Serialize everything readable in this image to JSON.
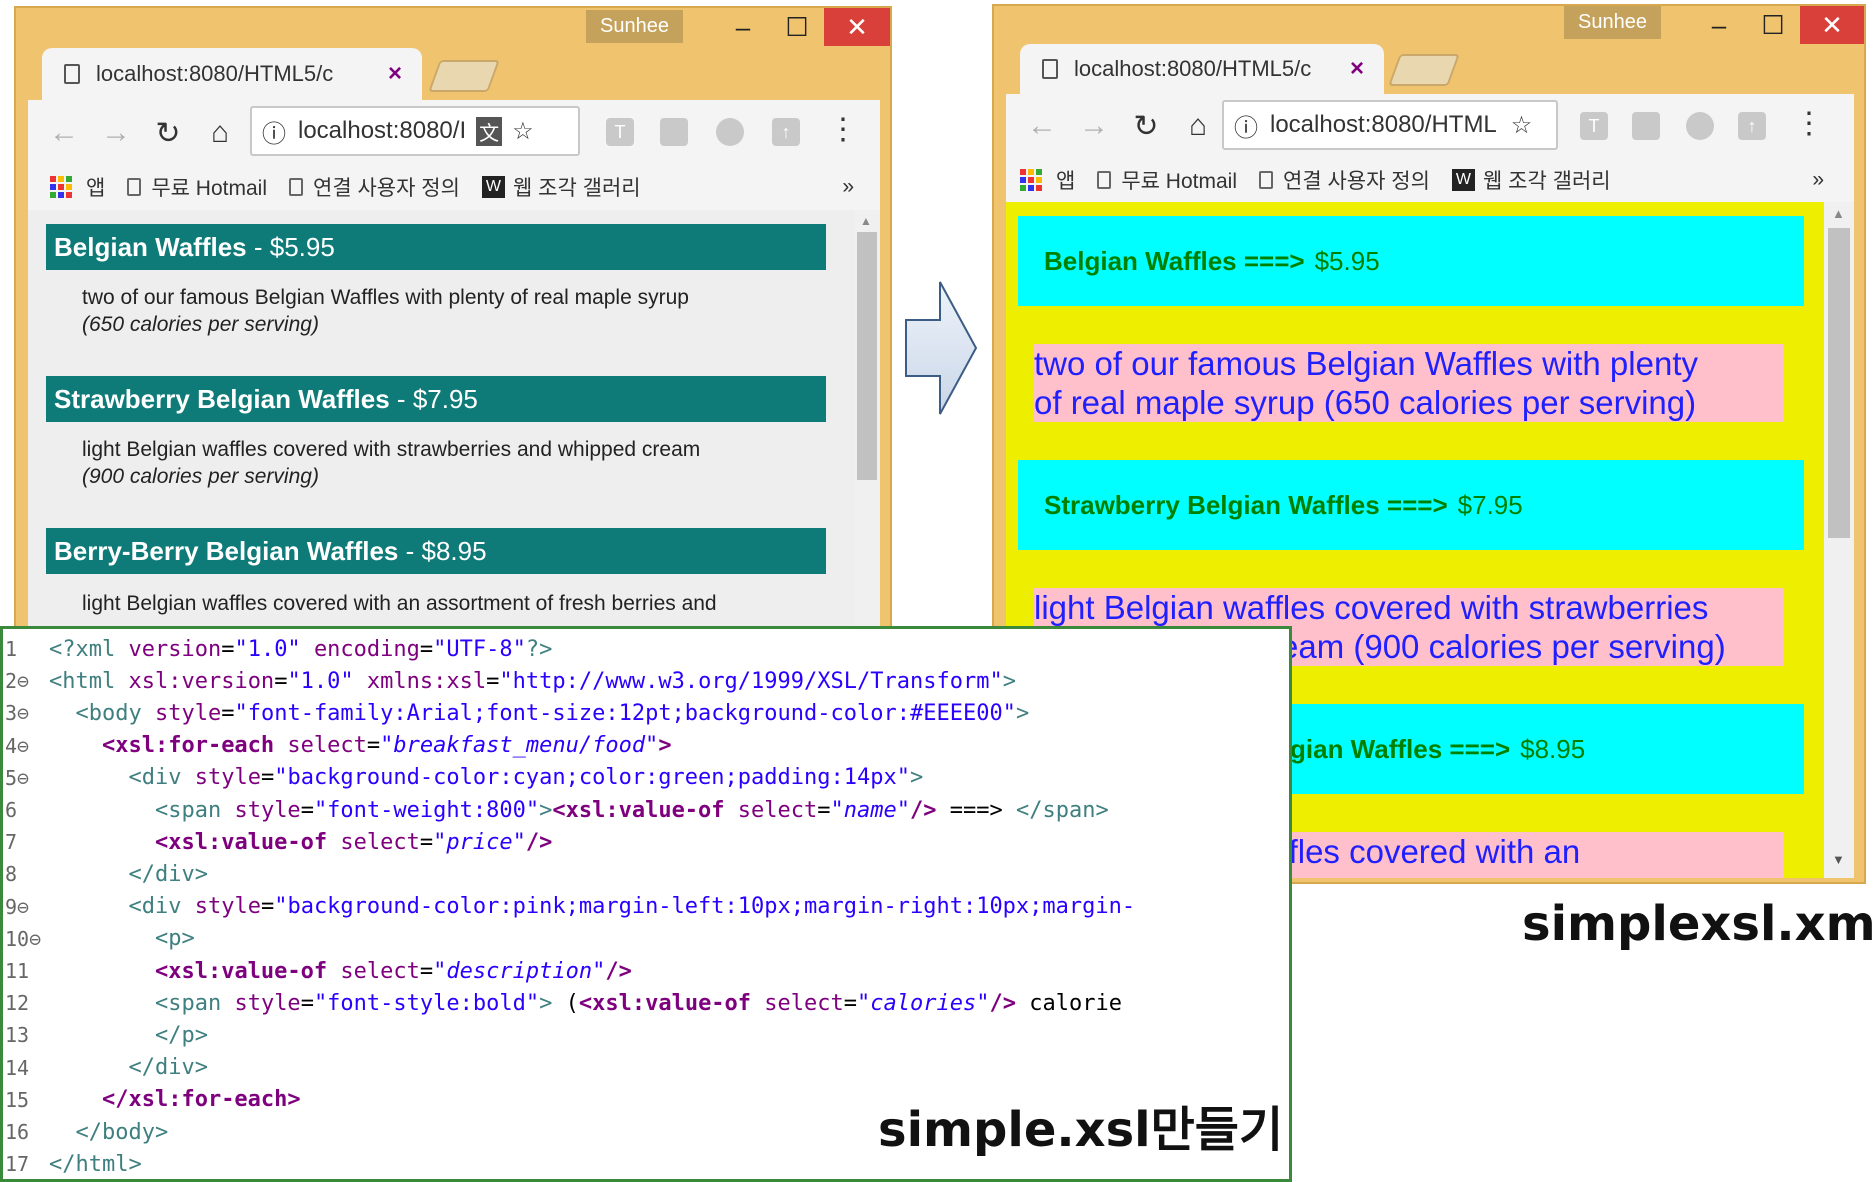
{
  "left_browser": {
    "user": "Sunhee",
    "controls": {
      "minimize": "–",
      "maximize": "☐",
      "close": "✕"
    },
    "tab_title": "localhost:8080/HTML5/c",
    "tab_close": "×",
    "address": "localhost:8080/I",
    "bookmarks": [
      "앱",
      "무료 Hotmail",
      "연결 사용자 정의",
      "웹 조각 갤러리"
    ],
    "more": "»",
    "foods": [
      {
        "name": "Belgian Waffles",
        "sep": " - ",
        "price": "$5.95",
        "desc": "two of our famous Belgian Waffles with plenty of real maple syrup",
        "cal": "(650 calories per serving)"
      },
      {
        "name": "Strawberry Belgian Waffles",
        "sep": " - ",
        "price": "$7.95",
        "desc": "light Belgian waffles covered with strawberries and whipped cream",
        "cal": "(900 calories per serving)"
      },
      {
        "name": "Berry-Berry Belgian Waffles",
        "sep": " - ",
        "price": "$8.95",
        "desc": "light Belgian waffles covered with an assortment of fresh berries and",
        "cal": ""
      }
    ]
  },
  "right_browser": {
    "user": "Sunhee",
    "controls": {
      "minimize": "–",
      "maximize": "☐",
      "close": "✕"
    },
    "tab_title": "localhost:8080/HTML5/c",
    "tab_close": "×",
    "address": "localhost:8080/HTML",
    "bookmarks": [
      "앱",
      "무료 Hotmail",
      "연결 사용자 정의",
      "웹 조각 갤러리"
    ],
    "more": "»",
    "blocks": [
      {
        "name": "Belgian Waffles ===>",
        "price": "$5.95",
        "desc_l1": "two of our famous Belgian Waffles with plenty",
        "desc_l2": "of real maple syrup (650 calories per serving)"
      },
      {
        "name": "Strawberry Belgian Waffles ===>",
        "price": "$7.95",
        "desc_l1": "light Belgian waffles covered with strawberries",
        "desc_l2": "eam (900 calories per serving)"
      },
      {
        "name": "gian Waffles ===>",
        "price": "$8.95",
        "desc_l1": "ffles covered with an",
        "desc_l2": ""
      }
    ]
  },
  "code_lines": [
    {
      "n": "1",
      "parts": [
        [
          "t",
          "<?"
        ],
        [
          "t",
          "xml "
        ],
        [
          "a",
          "version"
        ],
        [
          "p",
          "="
        ],
        [
          "s",
          "\"1.0\" "
        ],
        [
          "a",
          "encoding"
        ],
        [
          "p",
          "="
        ],
        [
          "s",
          "\"UTF-8\""
        ],
        [
          "t",
          "?>"
        ]
      ]
    },
    {
      "n": "2⊖",
      "parts": [
        [
          "t",
          "<html "
        ],
        [
          "a",
          "xsl:version"
        ],
        [
          "p",
          "="
        ],
        [
          "s",
          "\"1.0\" "
        ],
        [
          "a",
          "xmlns:xsl"
        ],
        [
          "p",
          "="
        ],
        [
          "s",
          "\"http://www.w3.org/1999/XSL/Transform\""
        ],
        [
          "t",
          ">"
        ]
      ]
    },
    {
      "n": "3⊖",
      "parts": [
        [
          "p",
          "  "
        ],
        [
          "t",
          "<body "
        ],
        [
          "a",
          "style"
        ],
        [
          "p",
          "="
        ],
        [
          "s",
          "\"font-family:Arial;font-size:12pt;background-color:#EEEE00\""
        ],
        [
          "t",
          ">"
        ]
      ]
    },
    {
      "n": "4⊖",
      "parts": [
        [
          "p",
          "    "
        ],
        [
          "x",
          "<xsl:for-each "
        ],
        [
          "a",
          "select"
        ],
        [
          "p",
          "="
        ],
        [
          "i",
          "\"breakfast_menu/food\""
        ],
        [
          "x",
          ">"
        ]
      ]
    },
    {
      "n": "5⊖",
      "parts": [
        [
          "p",
          "      "
        ],
        [
          "t",
          "<div "
        ],
        [
          "a",
          "style"
        ],
        [
          "p",
          "="
        ],
        [
          "s",
          "\"background-color:cyan;color:green;padding:14px\""
        ],
        [
          "t",
          ">"
        ]
      ]
    },
    {
      "n": "6",
      "parts": [
        [
          "p",
          "        "
        ],
        [
          "t",
          "<span "
        ],
        [
          "a",
          "style"
        ],
        [
          "p",
          "="
        ],
        [
          "s",
          "\"font-weight:800\""
        ],
        [
          "t",
          ">"
        ],
        [
          "x",
          "<xsl:value-of "
        ],
        [
          "a",
          "select"
        ],
        [
          "p",
          "="
        ],
        [
          "i",
          "\"name\""
        ],
        [
          "x",
          "/>"
        ],
        [
          "p",
          " ===> "
        ],
        [
          "t",
          "</span>"
        ]
      ]
    },
    {
      "n": "7",
      "parts": [
        [
          "p",
          "        "
        ],
        [
          "x",
          "<xsl:value-of "
        ],
        [
          "a",
          "select"
        ],
        [
          "p",
          "="
        ],
        [
          "i",
          "\"price\""
        ],
        [
          "x",
          "/>"
        ]
      ]
    },
    {
      "n": "8",
      "parts": [
        [
          "p",
          "      "
        ],
        [
          "t",
          "</div>"
        ]
      ]
    },
    {
      "n": "9⊖",
      "parts": [
        [
          "p",
          "      "
        ],
        [
          "t",
          "<div "
        ],
        [
          "a",
          "style"
        ],
        [
          "p",
          "="
        ],
        [
          "s",
          "\"background-color:pink;margin-left:10px;margin-right:10px;margin-"
        ]
      ]
    },
    {
      "n": "10⊖",
      "parts": [
        [
          "p",
          "        "
        ],
        [
          "t",
          "<p>"
        ]
      ]
    },
    {
      "n": "11",
      "parts": [
        [
          "p",
          "        "
        ],
        [
          "x",
          "<xsl:value-of "
        ],
        [
          "a",
          "select"
        ],
        [
          "p",
          "="
        ],
        [
          "i",
          "\"description\""
        ],
        [
          "x",
          "/>"
        ]
      ]
    },
    {
      "n": "12",
      "parts": [
        [
          "p",
          "        "
        ],
        [
          "t",
          "<span "
        ],
        [
          "a",
          "style"
        ],
        [
          "p",
          "="
        ],
        [
          "s",
          "\"font-style:bold\""
        ],
        [
          "t",
          ">"
        ],
        [
          "p",
          " ("
        ],
        [
          "x",
          "<xsl:value-of "
        ],
        [
          "a",
          "select"
        ],
        [
          "p",
          "="
        ],
        [
          "i",
          "\"calories\""
        ],
        [
          "x",
          "/>"
        ],
        [
          "p",
          " calorie"
        ]
      ]
    },
    {
      "n": "13",
      "parts": [
        [
          "p",
          "        "
        ],
        [
          "t",
          "</p>"
        ]
      ]
    },
    {
      "n": "14",
      "parts": [
        [
          "p",
          "      "
        ],
        [
          "t",
          "</div>"
        ]
      ]
    },
    {
      "n": "15",
      "parts": [
        [
          "p",
          "    "
        ],
        [
          "x",
          "</xsl:for-each>"
        ]
      ]
    },
    {
      "n": "16",
      "parts": [
        [
          "p",
          "  "
        ],
        [
          "t",
          "</body>"
        ]
      ]
    },
    {
      "n": "17",
      "parts": [
        [
          "t",
          "</html>"
        ]
      ]
    }
  ],
  "captions": {
    "code": "simple.xsl만들기",
    "result": "simplexsl.xml"
  },
  "colors": {
    "frame": "#f0c36e",
    "teal": "#0e7b78",
    "cyan": "#00ffff",
    "yellow": "#eeee00",
    "pink": "#ffc0cb",
    "green": "#008000",
    "blue": "#2020ff"
  }
}
